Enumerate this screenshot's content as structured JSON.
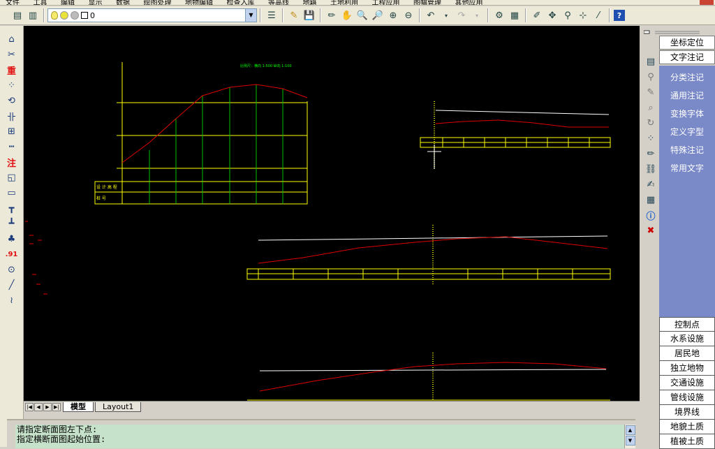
{
  "menubar": {
    "items": [
      "文件",
      "工具",
      "编辑",
      "显示",
      "数据",
      "绘图处理",
      "地物编辑",
      "检查入库",
      "等高线",
      "地籍",
      "土地利用",
      "工程应用",
      "图幅管理",
      "其他应用"
    ]
  },
  "toolbar": {
    "layer_name": "0"
  },
  "left_toolbar": {
    "zhong_label": "重",
    "zhu_label": "注",
    "num_label": ".91"
  },
  "tabs": {
    "model": "模型",
    "layout": "Layout1"
  },
  "command": {
    "line1": "请指定断面图左下点:",
    "line2": "指定横断面图起始位置:"
  },
  "right_panel": {
    "top_buttons": [
      "坐标定位",
      "文字注记"
    ],
    "category_items": [
      "分类注记",
      "通用注记",
      "变换字体",
      "定义字型",
      "特殊注记",
      "常用文字"
    ],
    "bottom_buttons": [
      "控制点",
      "水系设施",
      "居民地",
      "独立地物",
      "交通设施",
      "管线设施",
      "境界线",
      "地貌土质",
      "植被土质"
    ]
  },
  "drawing": {
    "scale_label": "比例尺：横向 1:500  纵向 1:100",
    "row_label_1": "设 计 高 程",
    "row_label_2": "桩    号",
    "colors": {
      "frame": "#ffff00",
      "grid": "#00c000",
      "profile": "#e00000",
      "line": "#ffffff",
      "text": "#00ff00"
    }
  }
}
